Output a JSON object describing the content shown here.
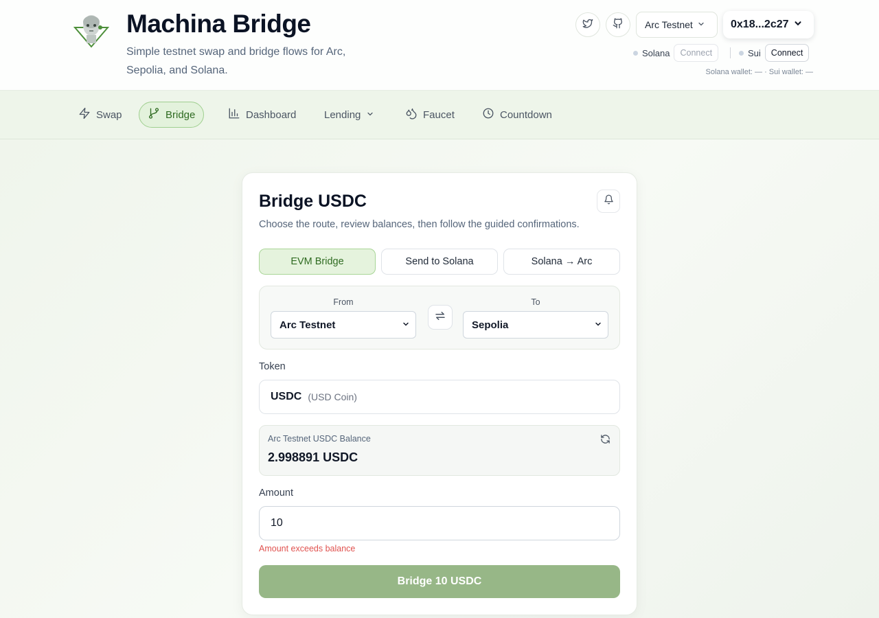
{
  "app": {
    "title": "Machina Bridge",
    "subtitle": "Simple testnet swap and bridge flows for Arc, Sepolia, and Solana."
  },
  "header": {
    "social_icons": [
      "twitter-icon",
      "github-icon"
    ],
    "network_select": "Arc Testnet",
    "wallet_address": "0x18...2c27",
    "solana": {
      "label": "Solana",
      "connect_label": "Connect"
    },
    "sui": {
      "label": "Sui",
      "connect_label": "Connect"
    },
    "wallet_status": "Solana wallet: — · Sui wallet: —"
  },
  "nav": {
    "items": [
      {
        "label": "Swap",
        "icon": "zap-icon"
      },
      {
        "label": "Bridge",
        "icon": "git-branch-icon",
        "active": true
      },
      {
        "label": "Dashboard",
        "icon": "bar-chart-icon"
      },
      {
        "label": "Lending",
        "icon": "chevron-down-icon"
      },
      {
        "label": "Faucet",
        "icon": "droplets-icon"
      },
      {
        "label": "Countdown",
        "icon": "clock-icon"
      }
    ]
  },
  "card": {
    "title": "Bridge USDC",
    "description": "Choose the route, review balances, then follow the guided confirmations.",
    "tabs": [
      {
        "label": "EVM Bridge",
        "active": true
      },
      {
        "label": "Send to Solana"
      },
      {
        "label": "Solana → Arc"
      }
    ],
    "route": {
      "from_label": "From",
      "from_value": "Arc Testnet",
      "to_label": "To",
      "to_value": "Sepolia"
    },
    "token": {
      "label": "Token",
      "symbol": "USDC",
      "name": "(USD Coin)"
    },
    "balance": {
      "label": "Arc Testnet USDC Balance",
      "value": "2.998891 USDC"
    },
    "amount": {
      "label": "Amount",
      "value": "10",
      "error": "Amount exceeds balance"
    },
    "submit_label": "Bridge 10 USDC"
  },
  "colors": {
    "accent_green": "#2f6b21",
    "active_tab_bg": "#e5f3dd",
    "button_disabled": "#97b787",
    "error": "#e0524f"
  }
}
